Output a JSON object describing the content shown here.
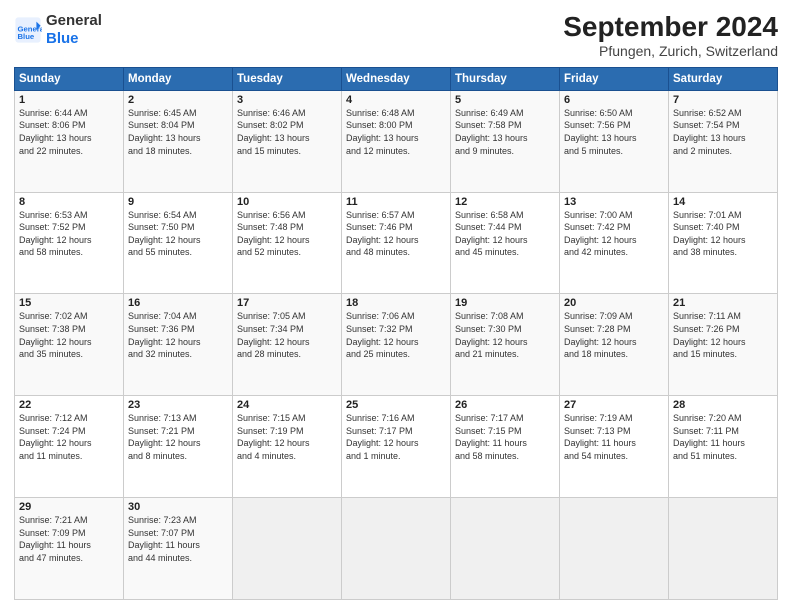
{
  "logo": {
    "line1": "General",
    "line2": "Blue"
  },
  "title": "September 2024",
  "subtitle": "Pfungen, Zurich, Switzerland",
  "days_header": [
    "Sunday",
    "Monday",
    "Tuesday",
    "Wednesday",
    "Thursday",
    "Friday",
    "Saturday"
  ],
  "weeks": [
    [
      {
        "day": "1",
        "lines": [
          "Sunrise: 6:44 AM",
          "Sunset: 8:06 PM",
          "Daylight: 13 hours",
          "and 22 minutes."
        ]
      },
      {
        "day": "2",
        "lines": [
          "Sunrise: 6:45 AM",
          "Sunset: 8:04 PM",
          "Daylight: 13 hours",
          "and 18 minutes."
        ]
      },
      {
        "day": "3",
        "lines": [
          "Sunrise: 6:46 AM",
          "Sunset: 8:02 PM",
          "Daylight: 13 hours",
          "and 15 minutes."
        ]
      },
      {
        "day": "4",
        "lines": [
          "Sunrise: 6:48 AM",
          "Sunset: 8:00 PM",
          "Daylight: 13 hours",
          "and 12 minutes."
        ]
      },
      {
        "day": "5",
        "lines": [
          "Sunrise: 6:49 AM",
          "Sunset: 7:58 PM",
          "Daylight: 13 hours",
          "and 9 minutes."
        ]
      },
      {
        "day": "6",
        "lines": [
          "Sunrise: 6:50 AM",
          "Sunset: 7:56 PM",
          "Daylight: 13 hours",
          "and 5 minutes."
        ]
      },
      {
        "day": "7",
        "lines": [
          "Sunrise: 6:52 AM",
          "Sunset: 7:54 PM",
          "Daylight: 13 hours",
          "and 2 minutes."
        ]
      }
    ],
    [
      {
        "day": "8",
        "lines": [
          "Sunrise: 6:53 AM",
          "Sunset: 7:52 PM",
          "Daylight: 12 hours",
          "and 58 minutes."
        ]
      },
      {
        "day": "9",
        "lines": [
          "Sunrise: 6:54 AM",
          "Sunset: 7:50 PM",
          "Daylight: 12 hours",
          "and 55 minutes."
        ]
      },
      {
        "day": "10",
        "lines": [
          "Sunrise: 6:56 AM",
          "Sunset: 7:48 PM",
          "Daylight: 12 hours",
          "and 52 minutes."
        ]
      },
      {
        "day": "11",
        "lines": [
          "Sunrise: 6:57 AM",
          "Sunset: 7:46 PM",
          "Daylight: 12 hours",
          "and 48 minutes."
        ]
      },
      {
        "day": "12",
        "lines": [
          "Sunrise: 6:58 AM",
          "Sunset: 7:44 PM",
          "Daylight: 12 hours",
          "and 45 minutes."
        ]
      },
      {
        "day": "13",
        "lines": [
          "Sunrise: 7:00 AM",
          "Sunset: 7:42 PM",
          "Daylight: 12 hours",
          "and 42 minutes."
        ]
      },
      {
        "day": "14",
        "lines": [
          "Sunrise: 7:01 AM",
          "Sunset: 7:40 PM",
          "Daylight: 12 hours",
          "and 38 minutes."
        ]
      }
    ],
    [
      {
        "day": "15",
        "lines": [
          "Sunrise: 7:02 AM",
          "Sunset: 7:38 PM",
          "Daylight: 12 hours",
          "and 35 minutes."
        ]
      },
      {
        "day": "16",
        "lines": [
          "Sunrise: 7:04 AM",
          "Sunset: 7:36 PM",
          "Daylight: 12 hours",
          "and 32 minutes."
        ]
      },
      {
        "day": "17",
        "lines": [
          "Sunrise: 7:05 AM",
          "Sunset: 7:34 PM",
          "Daylight: 12 hours",
          "and 28 minutes."
        ]
      },
      {
        "day": "18",
        "lines": [
          "Sunrise: 7:06 AM",
          "Sunset: 7:32 PM",
          "Daylight: 12 hours",
          "and 25 minutes."
        ]
      },
      {
        "day": "19",
        "lines": [
          "Sunrise: 7:08 AM",
          "Sunset: 7:30 PM",
          "Daylight: 12 hours",
          "and 21 minutes."
        ]
      },
      {
        "day": "20",
        "lines": [
          "Sunrise: 7:09 AM",
          "Sunset: 7:28 PM",
          "Daylight: 12 hours",
          "and 18 minutes."
        ]
      },
      {
        "day": "21",
        "lines": [
          "Sunrise: 7:11 AM",
          "Sunset: 7:26 PM",
          "Daylight: 12 hours",
          "and 15 minutes."
        ]
      }
    ],
    [
      {
        "day": "22",
        "lines": [
          "Sunrise: 7:12 AM",
          "Sunset: 7:24 PM",
          "Daylight: 12 hours",
          "and 11 minutes."
        ]
      },
      {
        "day": "23",
        "lines": [
          "Sunrise: 7:13 AM",
          "Sunset: 7:21 PM",
          "Daylight: 12 hours",
          "and 8 minutes."
        ]
      },
      {
        "day": "24",
        "lines": [
          "Sunrise: 7:15 AM",
          "Sunset: 7:19 PM",
          "Daylight: 12 hours",
          "and 4 minutes."
        ]
      },
      {
        "day": "25",
        "lines": [
          "Sunrise: 7:16 AM",
          "Sunset: 7:17 PM",
          "Daylight: 12 hours",
          "and 1 minute."
        ]
      },
      {
        "day": "26",
        "lines": [
          "Sunrise: 7:17 AM",
          "Sunset: 7:15 PM",
          "Daylight: 11 hours",
          "and 58 minutes."
        ]
      },
      {
        "day": "27",
        "lines": [
          "Sunrise: 7:19 AM",
          "Sunset: 7:13 PM",
          "Daylight: 11 hours",
          "and 54 minutes."
        ]
      },
      {
        "day": "28",
        "lines": [
          "Sunrise: 7:20 AM",
          "Sunset: 7:11 PM",
          "Daylight: 11 hours",
          "and 51 minutes."
        ]
      }
    ],
    [
      {
        "day": "29",
        "lines": [
          "Sunrise: 7:21 AM",
          "Sunset: 7:09 PM",
          "Daylight: 11 hours",
          "and 47 minutes."
        ]
      },
      {
        "day": "30",
        "lines": [
          "Sunrise: 7:23 AM",
          "Sunset: 7:07 PM",
          "Daylight: 11 hours",
          "and 44 minutes."
        ]
      },
      {
        "day": "",
        "lines": []
      },
      {
        "day": "",
        "lines": []
      },
      {
        "day": "",
        "lines": []
      },
      {
        "day": "",
        "lines": []
      },
      {
        "day": "",
        "lines": []
      }
    ]
  ]
}
